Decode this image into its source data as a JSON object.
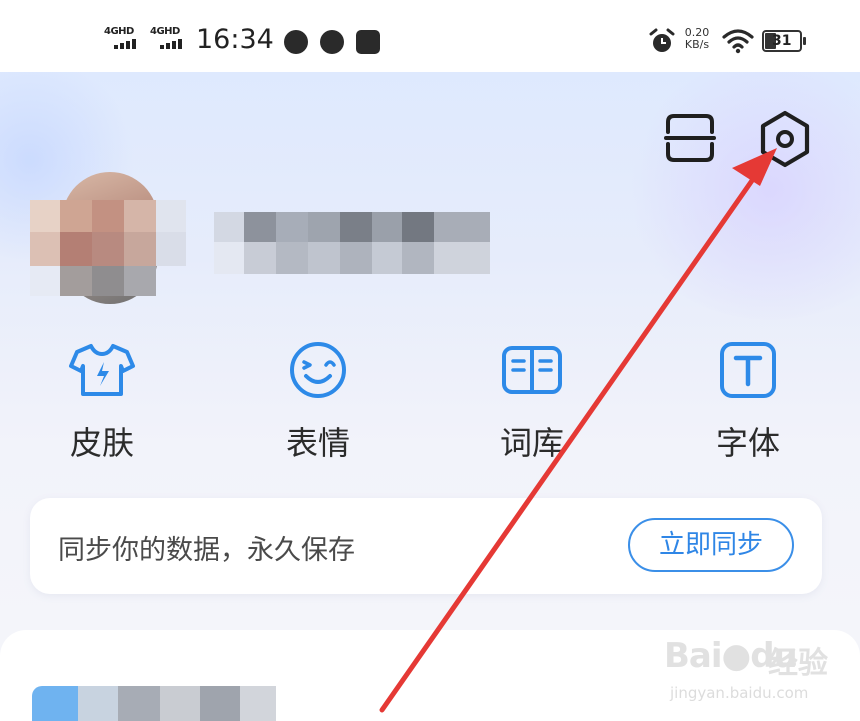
{
  "status_bar": {
    "network_1": "4GHD",
    "network_2": "4GHD",
    "time": "16:34",
    "net_speed_value": "0.20",
    "net_speed_unit": "KB/s",
    "battery": "31"
  },
  "header": {
    "scan_icon": "scan-icon",
    "settings_icon": "settings-hexagon-icon"
  },
  "profile": {
    "username": "██████"
  },
  "features": [
    {
      "label": "皮肤",
      "icon": "tshirt-icon"
    },
    {
      "label": "表情",
      "icon": "smiley-wink-icon"
    },
    {
      "label": "词库",
      "icon": "book-icon"
    },
    {
      "label": "字体",
      "icon": "font-t-icon"
    }
  ],
  "sync_card": {
    "text": "同步你的数据，永久保存",
    "button_label": "立即同步"
  },
  "watermark": {
    "brand": "Bai",
    "brand2": "du",
    "suffix": "经验",
    "url": "jingyan.baidu.com"
  },
  "colors": {
    "accent_blue": "#2f86e6",
    "annotation_red": "#e53935",
    "icon_blue": "#2d8ae8"
  }
}
